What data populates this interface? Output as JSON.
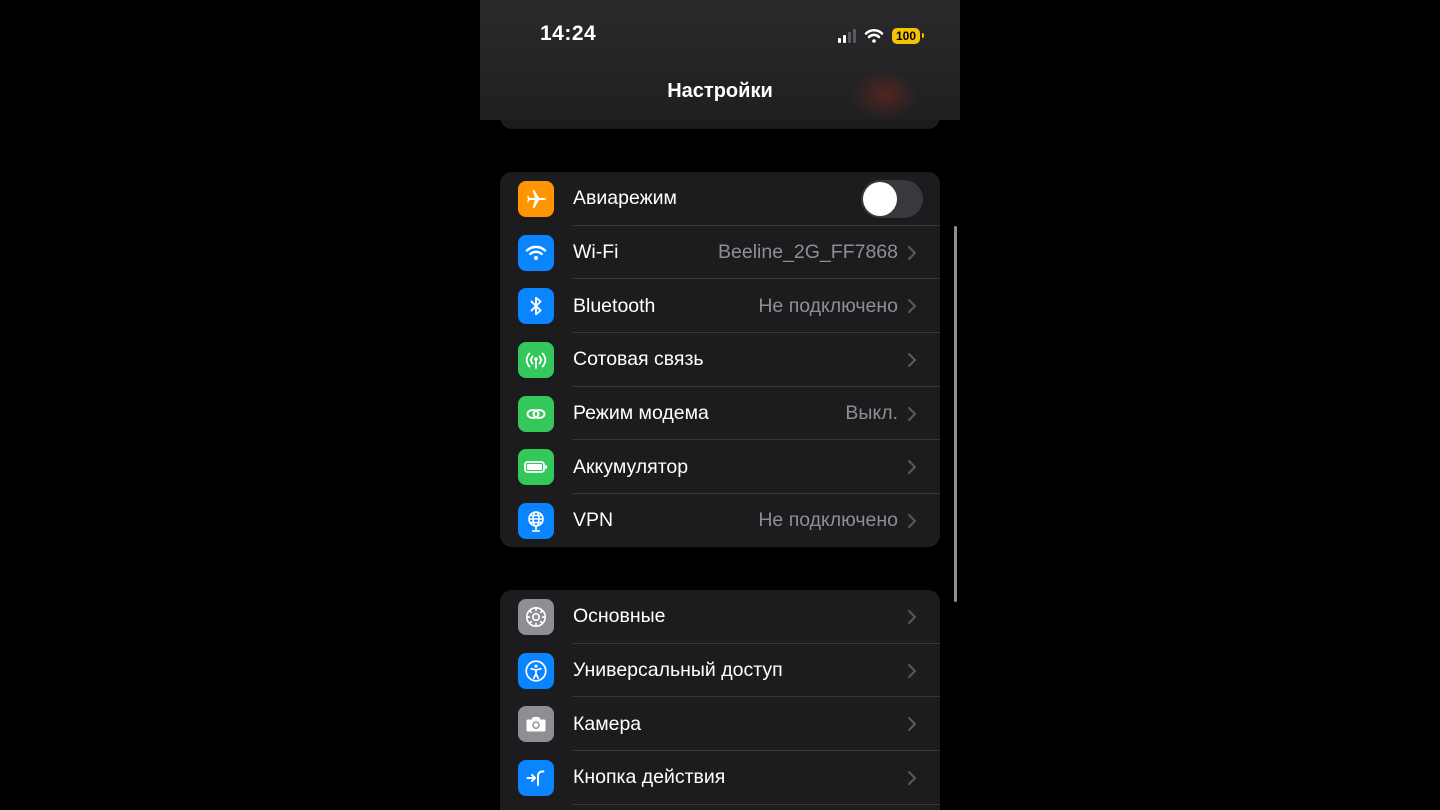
{
  "status_bar": {
    "time": "14:24",
    "battery": "100"
  },
  "nav": {
    "title": "Настройки"
  },
  "connectivity": [
    {
      "label": "Авиарежим",
      "icon": "airplane-icon",
      "color": "#ff9500",
      "toggle": false
    },
    {
      "label": "Wi-Fi",
      "value": "Beeline_2G_FF7868",
      "icon": "wifi-icon",
      "color": "#0a84ff"
    },
    {
      "label": "Bluetooth",
      "value": "Не подключено",
      "icon": "bluetooth-icon",
      "color": "#0a84ff"
    },
    {
      "label": "Сотовая связь",
      "value": "",
      "icon": "cellular-icon",
      "color": "#34c759"
    },
    {
      "label": "Режим модема",
      "value": "Выкл.",
      "icon": "hotspot-icon",
      "color": "#34c759"
    },
    {
      "label": "Аккумулятор",
      "value": "",
      "icon": "battery-icon",
      "color": "#34c759"
    },
    {
      "label": "VPN",
      "value": "Не подключено",
      "icon": "vpn-globe-icon",
      "color": "#0a84ff"
    }
  ],
  "general": [
    {
      "label": "Основные",
      "icon": "gear-icon",
      "color": "#8e8e93"
    },
    {
      "label": "Универсальный доступ",
      "icon": "accessibility-icon",
      "color": "#0a84ff"
    },
    {
      "label": "Камера",
      "icon": "camera-icon",
      "color": "#8e8e93"
    },
    {
      "label": "Кнопка действия",
      "icon": "action-button-icon",
      "color": "#0a84ff"
    }
  ]
}
